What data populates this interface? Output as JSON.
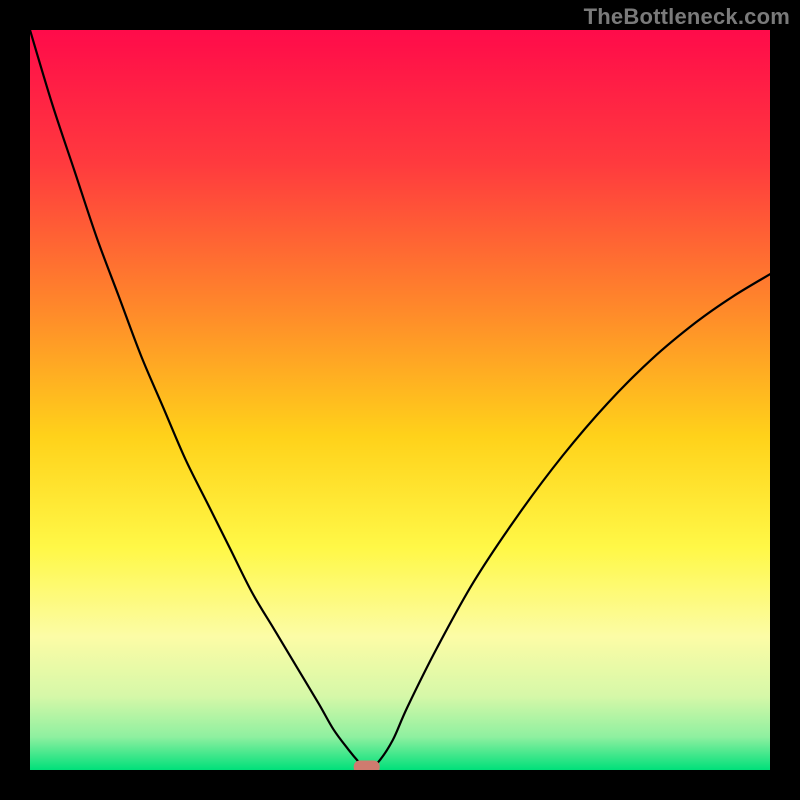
{
  "watermark": {
    "text": "TheBottleneck.com"
  },
  "colors": {
    "gradient_stops": [
      {
        "offset": 0.0,
        "color": "#ff0b4a"
      },
      {
        "offset": 0.18,
        "color": "#ff3a3e"
      },
      {
        "offset": 0.38,
        "color": "#ff8a2a"
      },
      {
        "offset": 0.55,
        "color": "#ffd21a"
      },
      {
        "offset": 0.7,
        "color": "#fff847"
      },
      {
        "offset": 0.82,
        "color": "#fcfca6"
      },
      {
        "offset": 0.9,
        "color": "#d6f8a8"
      },
      {
        "offset": 0.955,
        "color": "#8ff0a0"
      },
      {
        "offset": 1.0,
        "color": "#00e07a"
      }
    ],
    "curve": "#000000",
    "marker": "#cf7b6f",
    "frame_bg": "#000000"
  },
  "chart_data": {
    "type": "line",
    "title": "",
    "xlabel": "",
    "ylabel": "",
    "x": [
      0.0,
      0.03,
      0.06,
      0.09,
      0.12,
      0.15,
      0.18,
      0.21,
      0.24,
      0.27,
      0.3,
      0.33,
      0.36,
      0.39,
      0.41,
      0.43,
      0.445,
      0.455,
      0.47,
      0.49,
      0.51,
      0.55,
      0.6,
      0.66,
      0.72,
      0.78,
      0.84,
      0.9,
      0.95,
      1.0
    ],
    "values": [
      1.0,
      0.9,
      0.81,
      0.72,
      0.64,
      0.56,
      0.49,
      0.42,
      0.36,
      0.3,
      0.24,
      0.19,
      0.14,
      0.09,
      0.055,
      0.028,
      0.01,
      0.0,
      0.01,
      0.04,
      0.085,
      0.165,
      0.255,
      0.345,
      0.425,
      0.495,
      0.555,
      0.605,
      0.64,
      0.67
    ],
    "xlim": [
      0,
      1
    ],
    "ylim": [
      0,
      1
    ],
    "grid": false,
    "legend": false,
    "marker": {
      "x": 0.455,
      "y": 0.0,
      "shape": "rounded-rect"
    }
  }
}
